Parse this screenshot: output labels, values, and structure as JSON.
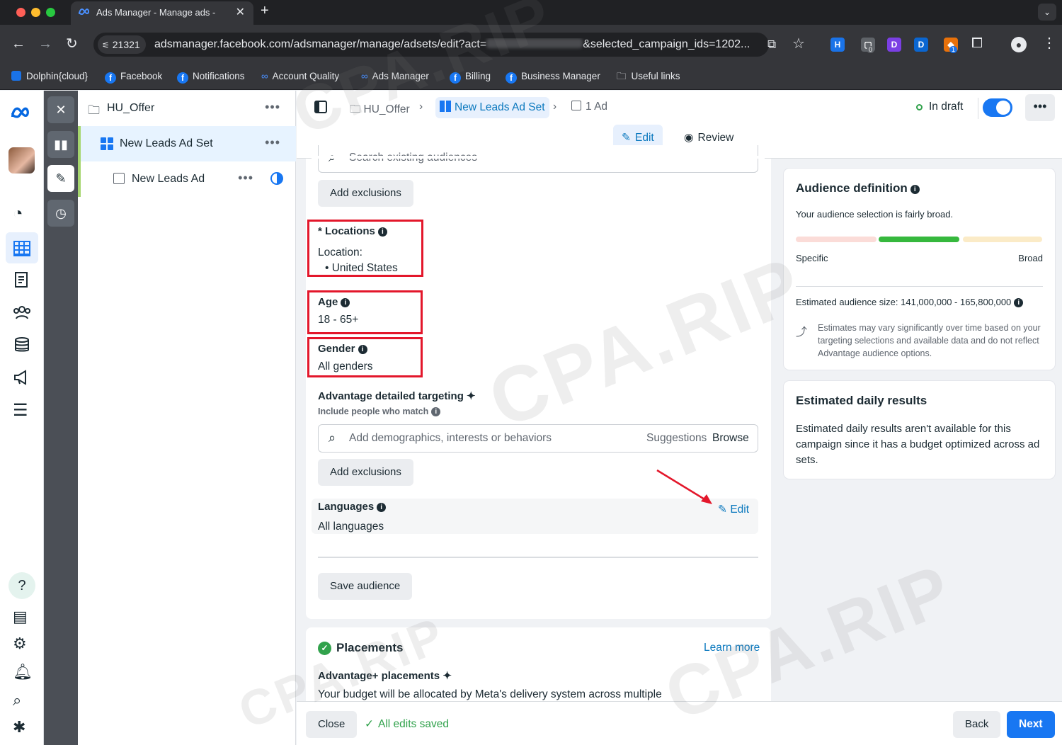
{
  "browser": {
    "tab_title": "Ads Manager - Manage ads -",
    "new_tab": "+",
    "site_badge": "21321",
    "url_prefix": "adsmanager.facebook.com/adsmanager/manage/adsets/edit?act=",
    "url_suffix": "&selected_campaign_ids=1202...",
    "bookmarks": [
      "Dolphin{cloud}",
      "Facebook",
      "Notifications",
      "Account Quality",
      "Ads Manager",
      "Billing",
      "Business Manager",
      "Useful links"
    ],
    "ext_badges": [
      "0",
      "1"
    ]
  },
  "tree": {
    "campaign": "HU_Offer",
    "adset": "New Leads Ad Set",
    "ad": "New Leads Ad",
    "more": "•••"
  },
  "breadcrumb": {
    "campaign": "HU_Offer",
    "adset": "New Leads Ad Set",
    "ad": "1 Ad"
  },
  "status": {
    "label": "In draft",
    "toggle_on": true
  },
  "mode_tabs": {
    "edit": "Edit",
    "review": "Review"
  },
  "audience_form": {
    "search_placeholder": "Search existing audiences",
    "add_exclusions_1": "Add exclusions",
    "locations_label": "* Locations",
    "location_heading": "Location:",
    "location_value": "United States",
    "age_label": "Age",
    "age_value": "18 - 65+",
    "gender_label": "Gender",
    "gender_value": "All genders",
    "advantage_label": "Advantage detailed targeting",
    "include_label": "Include people who match",
    "targeting_placeholder": "Add demographics, interests or behaviors",
    "suggestions": "Suggestions",
    "browse": "Browse",
    "add_exclusions_2": "Add exclusions",
    "languages_label": "Languages",
    "languages_value": "All languages",
    "languages_edit": "Edit",
    "save_audience": "Save audience"
  },
  "placements": {
    "title": "Placements",
    "learn_more": "Learn more",
    "subtitle": "Advantage+ placements",
    "description": "Your budget will be allocated by Meta's delivery system across multiple"
  },
  "audience_definition": {
    "title": "Audience definition",
    "summary": "Your audience selection is fairly broad.",
    "specific": "Specific",
    "broad": "Broad",
    "size": "Estimated audience size: 141,000,000 - 165,800,000",
    "note": "Estimates may vary significantly over time based on your targeting selections and available data and do not reflect Advantage audience options."
  },
  "daily_results": {
    "title": "Estimated daily results",
    "text": "Estimated daily results aren't available for this campaign since it has a budget optimized across ad sets."
  },
  "footer": {
    "close": "Close",
    "saved": "All edits saved",
    "back": "Back",
    "next": "Next"
  },
  "watermark": "CPA.RIP",
  "colors": {
    "accent": "#0a78be",
    "primary_button": "#1877f2",
    "success": "#31a24c",
    "annotation_red": "#e3172b"
  }
}
